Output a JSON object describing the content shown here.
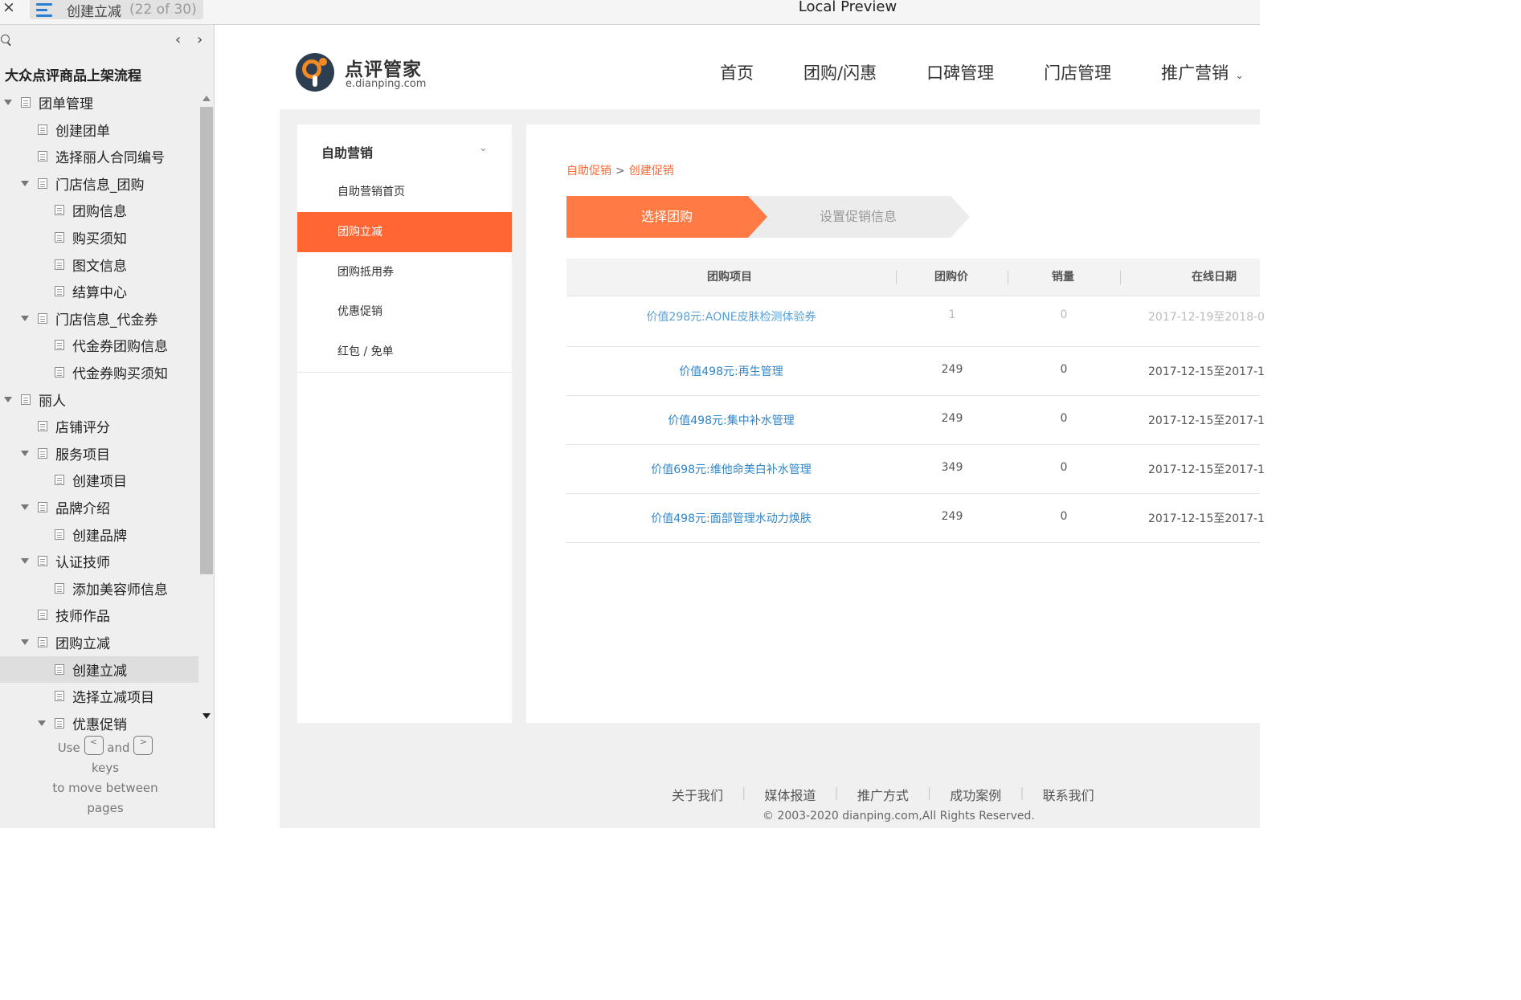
{
  "titlebar": {
    "close": "×",
    "tab_title": "创建立减",
    "tab_count": "(22 of 30)",
    "app_title": "Local Preview"
  },
  "sidebar": {
    "heading": "大众点评商品上架流程",
    "prev": "‹",
    "next": "›",
    "outline": [
      {
        "label": "团单管理",
        "level": 0,
        "expanded": true
      },
      {
        "label": "创建团单",
        "level": 1
      },
      {
        "label": "选择丽人合同编号",
        "level": 1
      },
      {
        "label": "门店信息_团购",
        "level": 1,
        "expanded": true
      },
      {
        "label": "团购信息",
        "level": 2
      },
      {
        "label": "购买须知",
        "level": 2
      },
      {
        "label": "图文信息",
        "level": 2
      },
      {
        "label": "结算中心",
        "level": 2
      },
      {
        "label": "门店信息_代金券",
        "level": 1,
        "expanded": true
      },
      {
        "label": "代金券团购信息",
        "level": 2
      },
      {
        "label": "代金券购买须知",
        "level": 2
      },
      {
        "label": "丽人",
        "level": 0,
        "expanded": true
      },
      {
        "label": "店铺评分",
        "level": 1
      },
      {
        "label": "服务项目",
        "level": 1,
        "expanded": true
      },
      {
        "label": "创建项目",
        "level": 2
      },
      {
        "label": "品牌介绍",
        "level": 1,
        "expanded": true
      },
      {
        "label": "创建品牌",
        "level": 2
      },
      {
        "label": "认证技师",
        "level": 1,
        "expanded": true
      },
      {
        "label": "添加美容师信息",
        "level": 2
      },
      {
        "label": "技师作品",
        "level": 1
      },
      {
        "label": "团购立减",
        "level": 1,
        "expanded": true
      },
      {
        "label": "创建立减",
        "level": 2,
        "selected": true
      },
      {
        "label": "选择立减项目",
        "level": 2
      },
      {
        "label": "优惠促销",
        "level": 2,
        "expanded": true
      }
    ],
    "hint": {
      "use": "Use",
      "key_prev": "<",
      "and": "and",
      "key_next": ">",
      "keys": "keys",
      "line2": "to move between",
      "line3": "pages"
    }
  },
  "site": {
    "brand_name": "点评管家",
    "brand_url": "e.dianping.com",
    "nav": [
      "首页",
      "团购/闪惠",
      "口碑管理",
      "门店管理",
      "推广营销"
    ],
    "nav_chevron": "⌄",
    "side_menu": {
      "title": "自助营销",
      "chevron": "⌄",
      "items": [
        "自助营销首页",
        "团购立减",
        "团购抵用券",
        "优惠促销",
        "红包 / 免单"
      ],
      "active_index": 1
    },
    "breadcrumb": {
      "first": "自助促销",
      "separator": ">",
      "second": "创建促销"
    },
    "steps": [
      "选择团购",
      "设置促销信息"
    ],
    "table": {
      "headers": [
        "团购项目",
        "团购价",
        "销量",
        "在线日期"
      ],
      "rows": [
        {
          "item": "价值298元:AONE皮肤检测体验券",
          "price": "1",
          "sales": "0",
          "date": "2017-12-19至2018-0",
          "dim": true
        },
        {
          "item": "价值498元:再生管理",
          "price": "249",
          "sales": "0",
          "date": "2017-12-15至2017-1"
        },
        {
          "item": "价值498元:集中补水管理",
          "price": "249",
          "sales": "0",
          "date": "2017-12-15至2017-1"
        },
        {
          "item": "价值698元:维他命美白补水管理",
          "price": "349",
          "sales": "0",
          "date": "2017-12-15至2017-1"
        },
        {
          "item": "价值498元:面部管理水动力焕肤",
          "price": "249",
          "sales": "0",
          "date": "2017-12-15至2017-1"
        }
      ]
    },
    "footer": {
      "links": [
        "关于我们",
        "媒体报道",
        "推广方式",
        "成功案例",
        "联系我们"
      ],
      "copyright": "© 2003-2020 dianping.com,All Rights Reserved."
    }
  },
  "colors": {
    "accent": "#ff6633",
    "link": "#2f85c8",
    "step_active": "#ff7a45"
  }
}
